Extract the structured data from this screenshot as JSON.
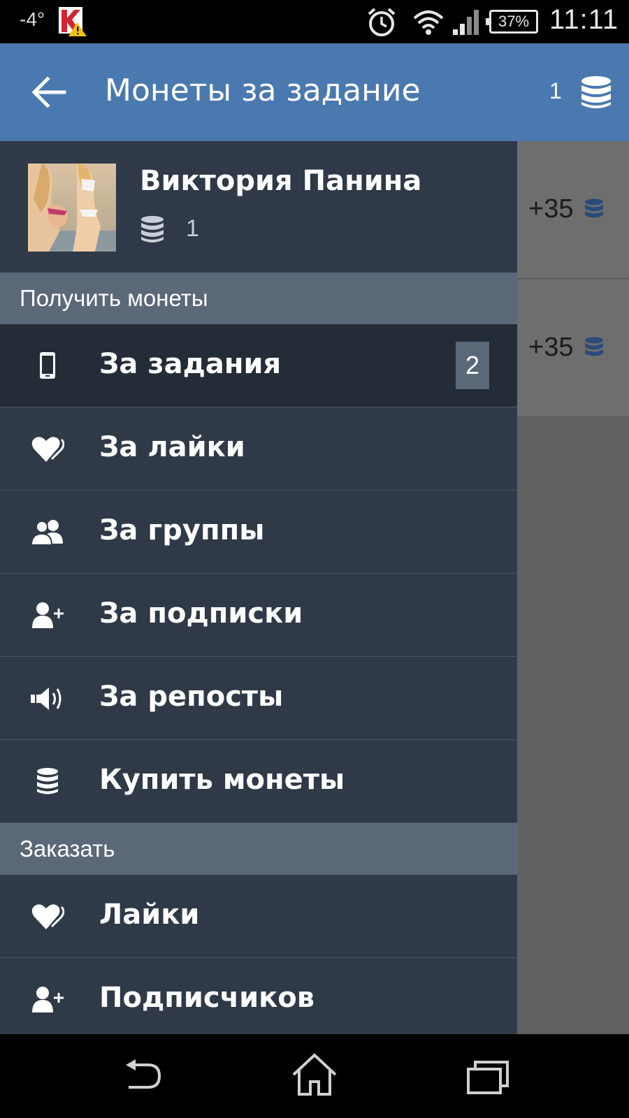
{
  "status_bar": {
    "temperature": "-4°",
    "battery": "37%",
    "time": "11:11"
  },
  "app_bar": {
    "title": "Монеты за задание",
    "coin_count": "1"
  },
  "background": {
    "rewards": [
      "+35",
      "+35"
    ]
  },
  "profile": {
    "name": "Виктория Панина",
    "coins": "1"
  },
  "sections": [
    {
      "title": "Получить монеты"
    },
    {
      "title": "Заказать"
    }
  ],
  "earn_items": [
    {
      "label": "За задания",
      "icon": "phone-icon",
      "badge": "2",
      "active": true
    },
    {
      "label": "За лайки",
      "icon": "heart-icon"
    },
    {
      "label": "За группы",
      "icon": "group-icon"
    },
    {
      "label": "За подписки",
      "icon": "add-user-icon"
    },
    {
      "label": "За репосты",
      "icon": "megaphone-icon"
    },
    {
      "label": "Купить монеты",
      "icon": "coins-icon"
    }
  ],
  "order_items": [
    {
      "label": "Лайки",
      "icon": "heart-icon"
    },
    {
      "label": "Подписчиков",
      "icon": "add-user-icon"
    }
  ],
  "colors": {
    "app_bar": "#4a79b0",
    "drawer": "#2f3947",
    "drawer_active": "#242c38",
    "section_header": "#5a6878",
    "coin_blue": "#3a5f8f"
  }
}
